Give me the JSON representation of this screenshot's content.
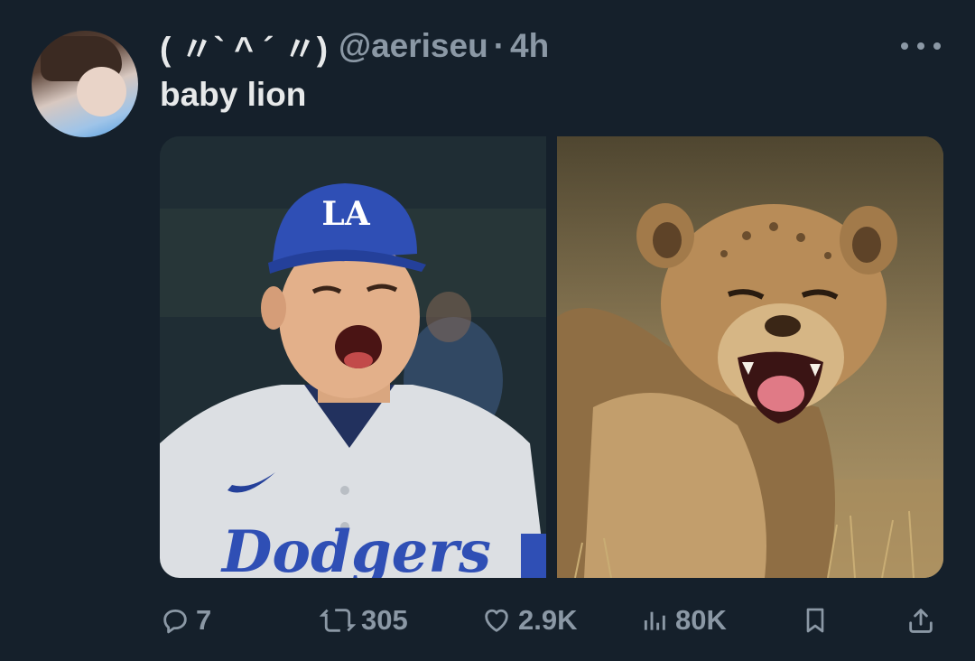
{
  "tweet": {
    "display_name": "( 〃` ^ ´ 〃)",
    "handle": "@aeriseu",
    "separator": "·",
    "time": "4h",
    "text": "baby lion"
  },
  "media": {
    "left_image": "baseball-player-shouting-photo",
    "right_image": "lion-cub-roaring-photo",
    "cap_logo_text": "LA",
    "jersey_text": "Dodgers"
  },
  "actions": {
    "reply_count": "7",
    "retweet_count": "305",
    "like_count": "2.9K",
    "view_count": "80K"
  },
  "colors": {
    "background": "#15202b",
    "primary_text": "#e7e9ea",
    "secondary_text": "#8b98a5",
    "dodgers_blue": "#2f4fb5"
  }
}
